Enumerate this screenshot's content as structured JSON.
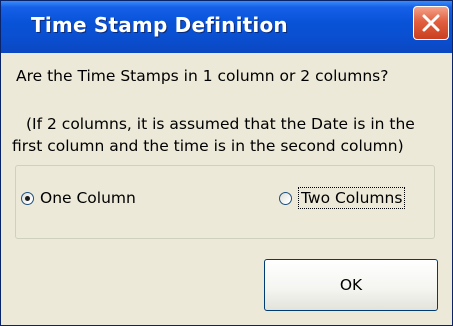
{
  "dialog": {
    "title": "Time Stamp Definition",
    "close_icon": "close-x-icon",
    "prompt": "Are the Time Stamps in 1 column or 2 columns?",
    "note_line1": "(If 2 columns, it is assumed that the Date is in the",
    "note_line2": "first column and the time is in the second column)",
    "options": [
      {
        "label": "One Column",
        "selected": true
      },
      {
        "label": "Two Columns",
        "selected": false,
        "focused": true
      }
    ],
    "ok_label": "OK"
  },
  "colors": {
    "titlebar": "#0a4fd0",
    "dialog_background": "#ece9d8",
    "close_button": "#e1603f"
  }
}
